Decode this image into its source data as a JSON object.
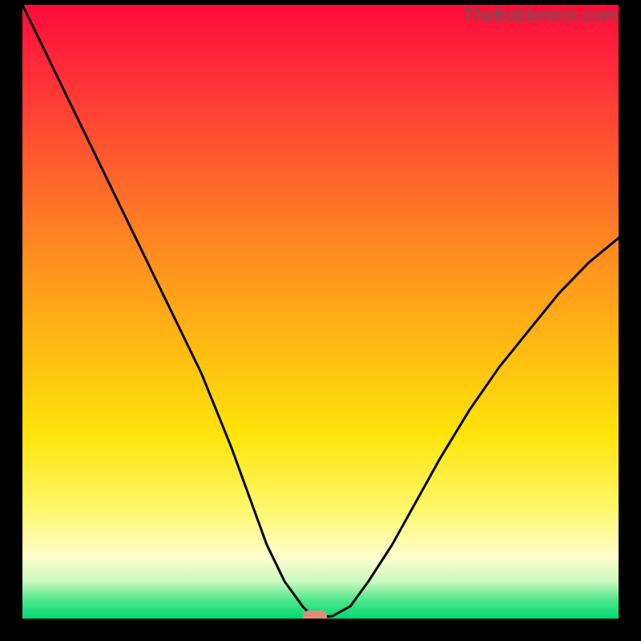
{
  "watermark": "TheBottleneck.com",
  "marker_color": "#e58a78",
  "chart_data": {
    "type": "line",
    "title": "",
    "xlabel": "",
    "ylabel": "",
    "xlim": [
      0,
      100
    ],
    "ylim": [
      0,
      100
    ],
    "x": [
      0,
      5,
      10,
      15,
      20,
      25,
      30,
      35,
      38,
      41,
      44,
      47,
      48.5,
      50,
      52,
      55,
      58,
      62,
      66,
      70,
      75,
      80,
      85,
      90,
      95,
      100
    ],
    "values": [
      100,
      90,
      80,
      70,
      60,
      50,
      40,
      28,
      20,
      12,
      6,
      2,
      0.5,
      0.3,
      0.4,
      2,
      6,
      12,
      19,
      26,
      34,
      41,
      47,
      53,
      58,
      62
    ],
    "annotations": [
      {
        "name": "min-marker",
        "x": 49,
        "y": 0.4
      }
    ],
    "background_gradient_meaning": "red-high-bottleneck-to-green-low-bottleneck"
  }
}
